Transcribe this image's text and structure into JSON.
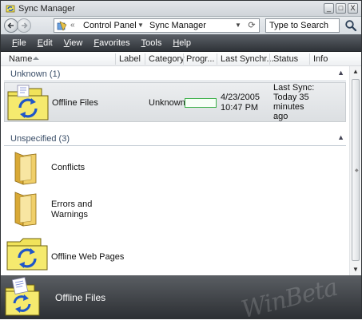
{
  "window": {
    "title": "Sync Manager",
    "controls": {
      "minimize": "_",
      "maximize": "□",
      "close": "X"
    }
  },
  "address_bar": {
    "breadcrumb_separator": "«",
    "breadcrumbs": [
      "Control Panel",
      "Sync Manager"
    ],
    "search_placeholder": "Type to Search"
  },
  "menu": {
    "items": [
      "File",
      "Edit",
      "View",
      "Favorites",
      "Tools",
      "Help"
    ]
  },
  "columns": {
    "name": "Name",
    "label": "Label",
    "category": "Category",
    "progress": "Progr...",
    "last_sync": "Last Synchr...",
    "status": "Status",
    "info": "Info"
  },
  "groups": [
    {
      "label": "Unknown (1)",
      "items": [
        {
          "name": "Offline Files",
          "category": "Unknown",
          "progress": 0,
          "last_sync_date": "4/23/2005",
          "last_sync_time": "10:47 PM",
          "status_line1": "Last Sync:",
          "status_line2": "Today 35",
          "status_line3": "minutes",
          "status_line4": "ago"
        }
      ]
    },
    {
      "label": "Unspecified (3)",
      "items": [
        {
          "name": "Conflicts"
        },
        {
          "name_line1": "Errors and",
          "name_line2": "Warnings"
        },
        {
          "name": "Offline Web Pages"
        }
      ]
    }
  ],
  "details_pane": {
    "title": "Offline Files",
    "watermark": "WinBeta"
  },
  "colors": {
    "menubar": "#3d4146",
    "group_header_text": "#3a4e68",
    "progress_border": "#3cb04a",
    "sync_arrows": "#1f56c8",
    "folder": "#e8c45a",
    "sync_folder": "#f1e35a"
  },
  "icons": {
    "app": "sync-manager-icon",
    "sync_folder": "sync-folder-icon",
    "folder": "folder-icon",
    "search": "search-icon"
  }
}
